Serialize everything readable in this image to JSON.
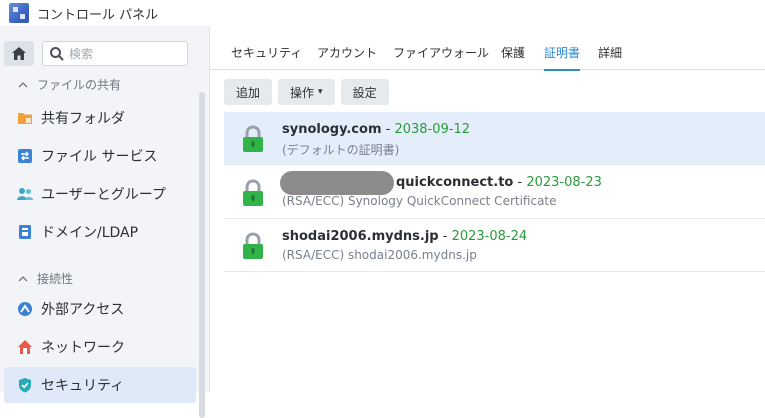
{
  "window": {
    "title": "コントロール パネル"
  },
  "sidebar": {
    "search_placeholder": "検索",
    "sections": [
      {
        "label": "ファイルの共有"
      },
      {
        "label": "接続性"
      }
    ],
    "items": [
      {
        "label": "共有フォルダ",
        "icon": "shared-folder-icon"
      },
      {
        "label": "ファイル サービス",
        "icon": "file-services-icon"
      },
      {
        "label": "ユーザーとグループ",
        "icon": "users-groups-icon"
      },
      {
        "label": "ドメイン/LDAP",
        "icon": "domain-ldap-icon"
      },
      {
        "label": "外部アクセス",
        "icon": "external-access-icon"
      },
      {
        "label": "ネットワーク",
        "icon": "network-icon"
      },
      {
        "label": "セキュリティ",
        "icon": "security-shield-icon",
        "active": true
      }
    ]
  },
  "tabs": [
    {
      "label": "セキュリティ"
    },
    {
      "label": "アカウント"
    },
    {
      "label": "ファイアウォール"
    },
    {
      "label": "保護"
    },
    {
      "label": "証明書",
      "active": true
    },
    {
      "label": "詳細"
    }
  ],
  "toolbar": {
    "add_label": "追加",
    "action_label": "操作",
    "settings_label": "設定"
  },
  "certificates": [
    {
      "name": "synology.com",
      "separator": " - ",
      "expires": "2038-09-12",
      "description": "(デフォルトの証明書)",
      "selected": true
    },
    {
      "name": "quickconnect.to",
      "separator": " - ",
      "expires": "2023-08-23",
      "description": "(RSA/ECC) Synology QuickConnect Certificate"
    },
    {
      "name": "shodai2006.mydns.jp",
      "separator": " - ",
      "expires": "2023-08-24",
      "description": "(RSA/ECC) shodai2006.mydns.jp"
    }
  ],
  "colors": {
    "accent": "#2d8bd6",
    "date_green": "#2a9a3c",
    "lock_green": "#32b34a",
    "selected_row": "#e4eefa"
  }
}
